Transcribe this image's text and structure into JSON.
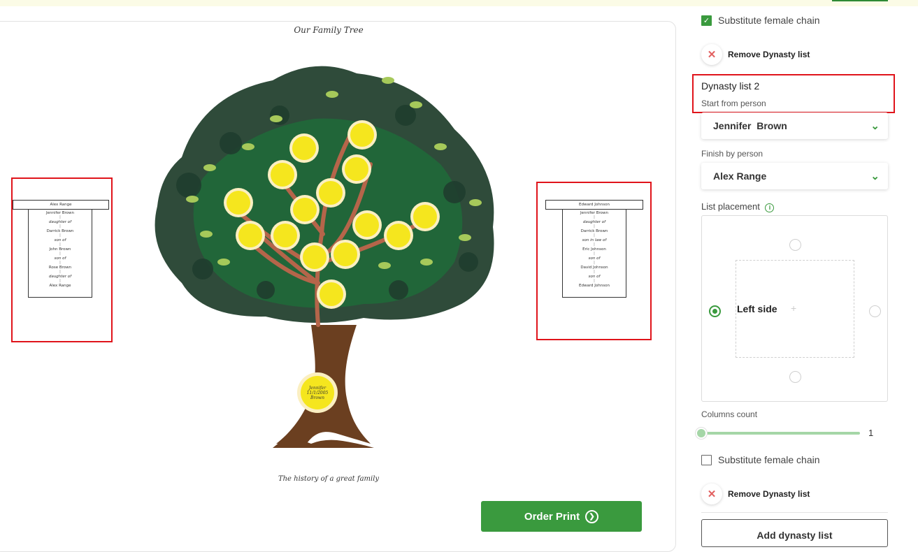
{
  "tree": {
    "title": "Our Family Tree",
    "subtitle": "The history of a great family",
    "root": {
      "line1": "Jennifer",
      "line2": "11/1/2005",
      "line3": "Brown"
    }
  },
  "dynasty_left": {
    "header": "Alex Range",
    "entries": [
      {
        "name": "Jennifer Brown",
        "rel": "daughter of"
      },
      {
        "name": "Darrick Brown",
        "rel": "son of"
      },
      {
        "name": "John Brown",
        "rel": "son of"
      },
      {
        "name": "Rose Brown",
        "rel": "daughter of"
      },
      {
        "name": "Alex Range",
        "rel": ""
      }
    ]
  },
  "dynasty_right": {
    "header": "Edward Johnson",
    "entries": [
      {
        "name": "Jennifer Brown",
        "rel": "daughter of"
      },
      {
        "name": "Darrick Brown",
        "rel": "son in law of"
      },
      {
        "name": "Eric Johnson",
        "rel": "son of"
      },
      {
        "name": "David Johnson",
        "rel": "son of"
      },
      {
        "name": "Edward Johnson",
        "rel": ""
      }
    ]
  },
  "actions": {
    "order_print": "Order Print"
  },
  "panel": {
    "substitute_female_1": "Substitute female chain",
    "remove_dynasty_1": "Remove Dynasty list",
    "dynasty_title": "Dynasty list 2",
    "start_from_label": "Start from person",
    "start_from_value": "Jennifer  Brown",
    "finish_by_label": "Finish by person",
    "finish_by_value": "Alex Range",
    "list_placement_label": "List placement",
    "placement_selected": "Left side",
    "plus_glyph": "+",
    "columns_count_label": "Columns count",
    "columns_count_value": "1",
    "substitute_female_2": "Substitute female chain",
    "remove_dynasty_2": "Remove Dynasty list",
    "add_dynasty": "Add dynasty list"
  },
  "colors": {
    "accent": "#3a9a3e",
    "highlight": "#e0141b",
    "leaf_dark": "#2f4b3a",
    "leaf_mid": "#1f6b3a",
    "branch": "#b5654a",
    "node": "#f5e61e"
  }
}
